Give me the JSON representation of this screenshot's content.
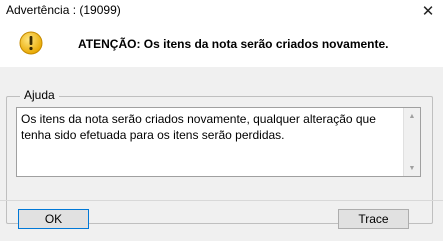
{
  "window": {
    "title": "Advertência : (19099)",
    "close_symbol": "✕"
  },
  "header": {
    "message": "ATENÇÃO: Os itens da nota serão criados novamente.",
    "icon": "warning-icon",
    "icon_color": "#f5c211"
  },
  "help": {
    "legend": "Ajuda",
    "text": "Os itens da nota serão criados novamente, qualquer alteração que tenha sido efetuada para os itens serão perdidas."
  },
  "buttons": {
    "ok_label": "OK",
    "trace_label": "Trace"
  }
}
